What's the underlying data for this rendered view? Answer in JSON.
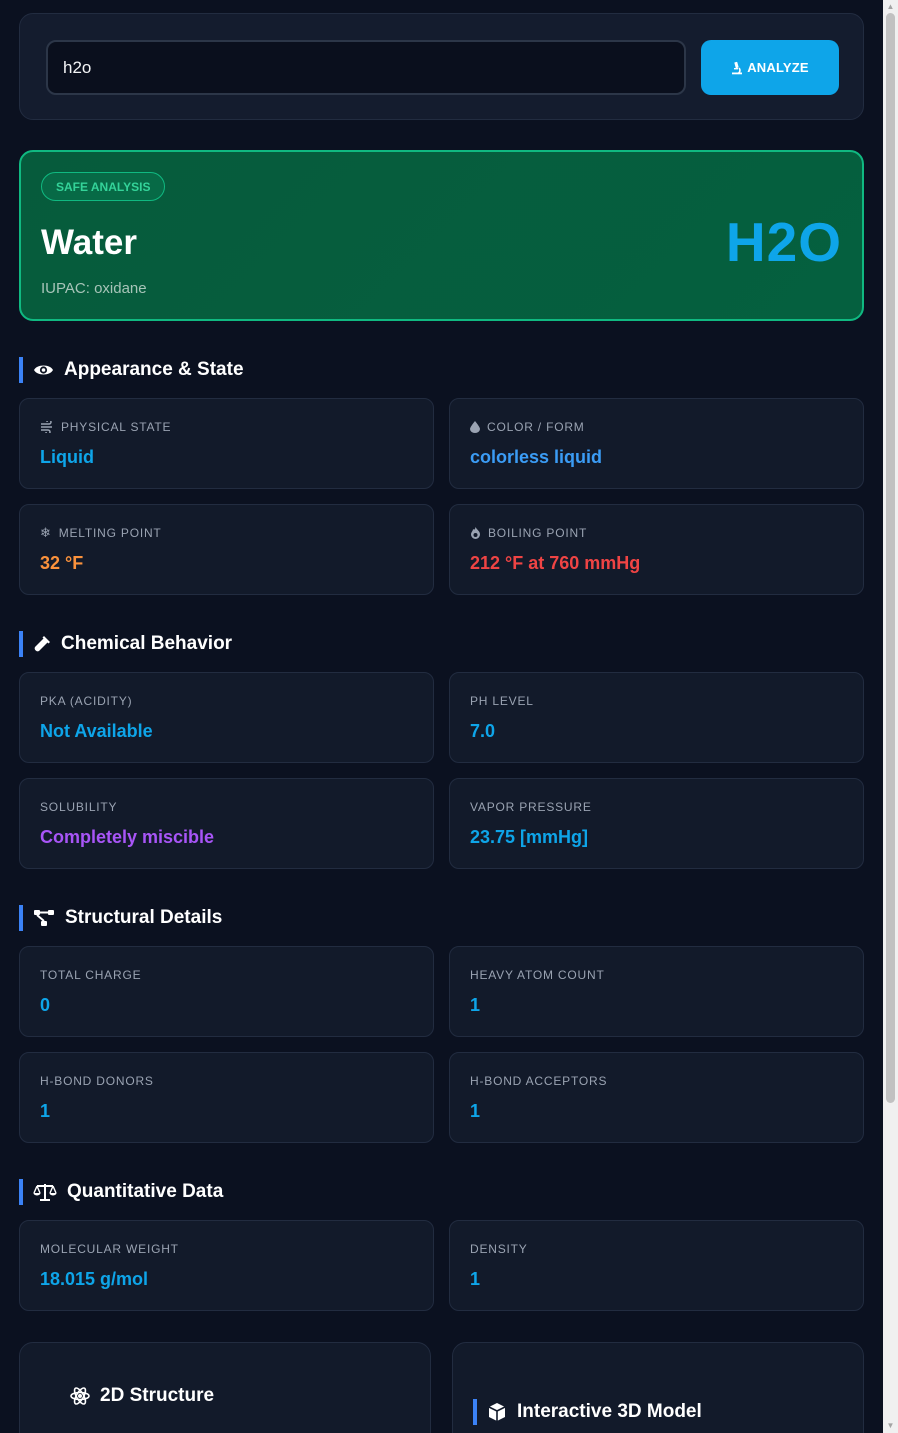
{
  "search": {
    "value": "h2o",
    "button_label": "ANALYZE"
  },
  "hero": {
    "badge": "SAFE ANALYSIS",
    "name": "Water",
    "iupac": "IUPAC: oxidane",
    "formula": "H2O"
  },
  "sections": {
    "appearance": {
      "title": "Appearance & State",
      "physical_state": {
        "label": "PHYSICAL STATE",
        "value": "Liquid"
      },
      "color_form": {
        "label": "COLOR / FORM",
        "value": "colorless liquid"
      },
      "melting_point": {
        "label": "MELTING POINT",
        "value": "32 °F"
      },
      "boiling_point": {
        "label": "BOILING POINT",
        "value": "212 °F at 760 mmHg"
      }
    },
    "chemical": {
      "title": "Chemical Behavior",
      "pka": {
        "label": "PKA (ACIDITY)",
        "value": "Not Available"
      },
      "ph": {
        "label": "PH LEVEL",
        "value": "7.0"
      },
      "solubility": {
        "label": "SOLUBILITY",
        "value": "Completely miscible"
      },
      "vapor_pressure": {
        "label": "VAPOR PRESSURE",
        "value": "23.75 [mmHg]"
      }
    },
    "structural": {
      "title": "Structural Details",
      "total_charge": {
        "label": "TOTAL CHARGE",
        "value": "0"
      },
      "heavy_atom_count": {
        "label": "HEAVY ATOM COUNT",
        "value": "1"
      },
      "hbond_donors": {
        "label": "H-BOND DONORS",
        "value": "1"
      },
      "hbond_acceptors": {
        "label": "H-BOND ACCEPTORS",
        "value": "1"
      }
    },
    "quantitative": {
      "title": "Quantitative Data",
      "molecular_weight": {
        "label": "MOLECULAR WEIGHT",
        "value": "18.015 g/mol"
      },
      "density": {
        "label": "DENSITY",
        "value": "1"
      }
    }
  },
  "panels": {
    "structure_2d": "2D Structure",
    "model_3d": "Interactive 3D Model"
  },
  "colors": {
    "accent": "#0ea5e9",
    "safe_green": "#10b981",
    "orange": "#fb923c",
    "red": "#ef4444",
    "purple": "#a855f7"
  }
}
